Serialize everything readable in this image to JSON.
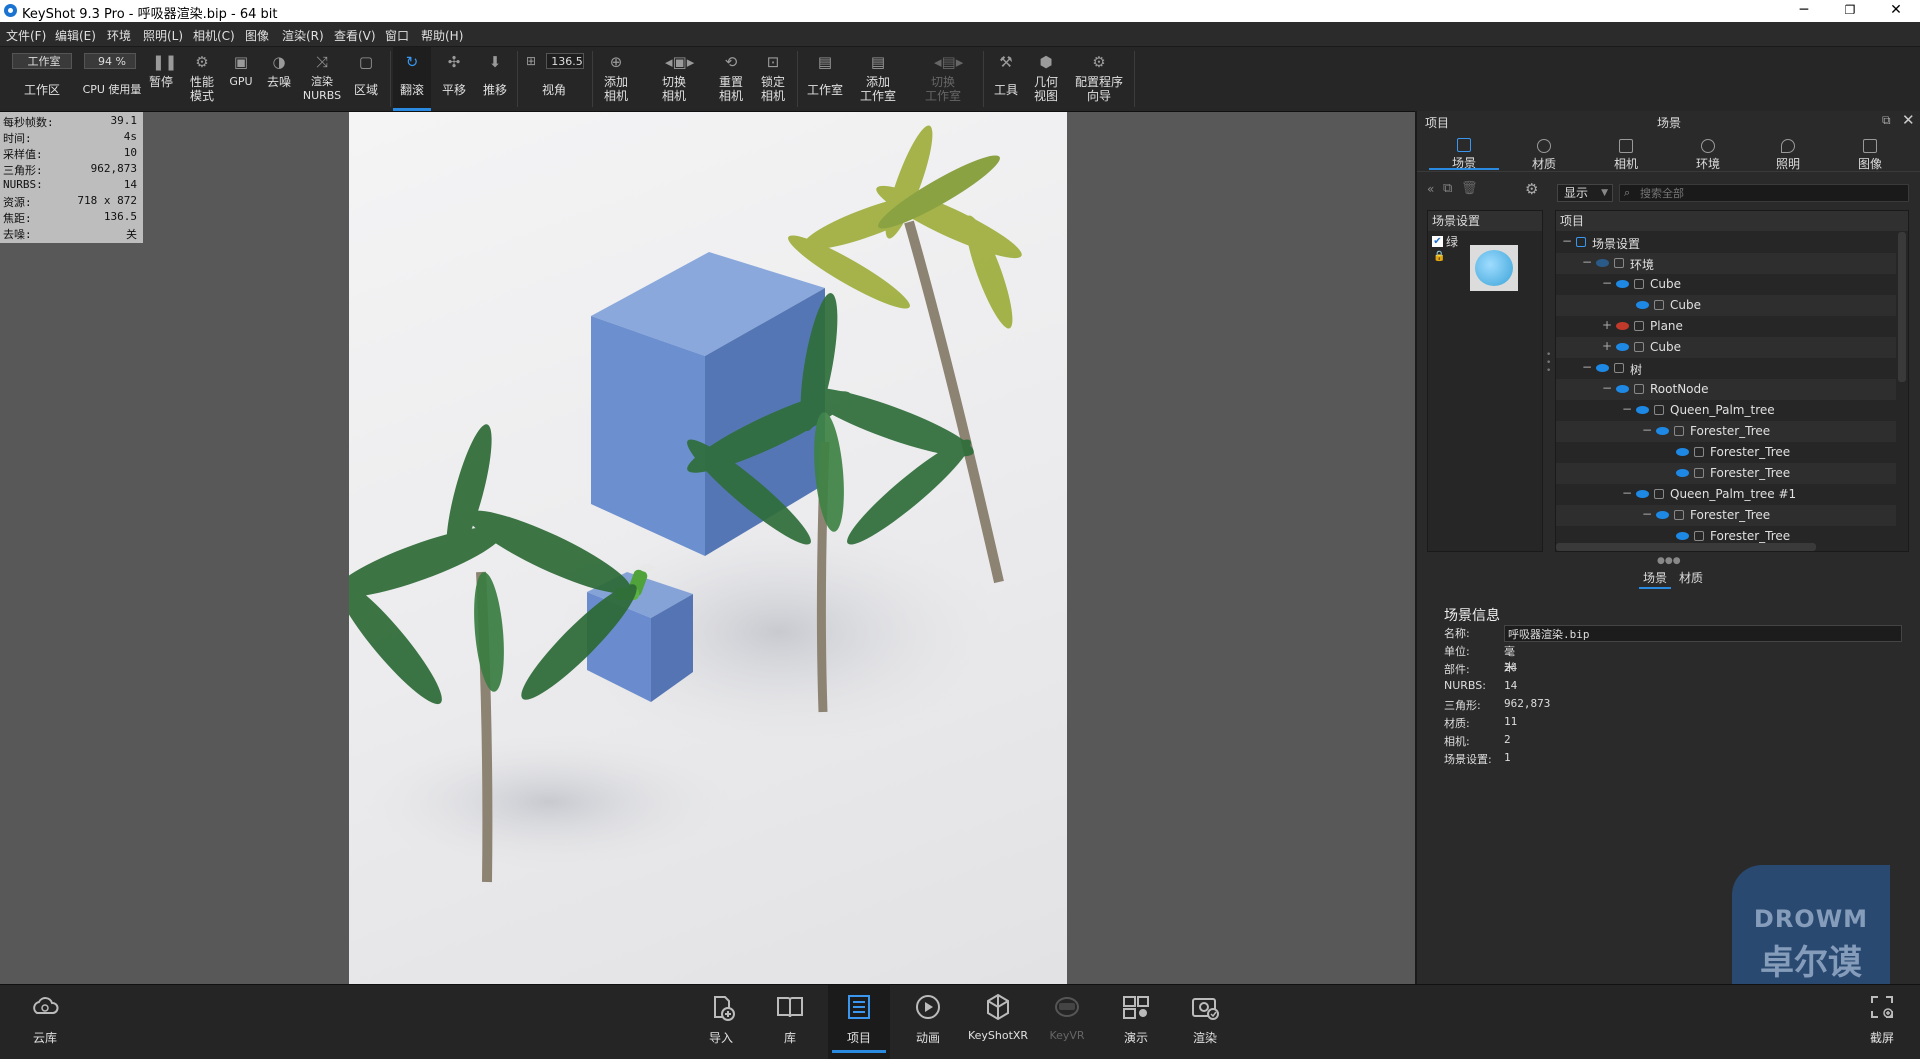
{
  "window": {
    "title": "KeyShot 9.3 Pro  - 呼吸器渲染.bip  - 64 bit",
    "minimize": "─",
    "maximize": "❐",
    "close": "✕"
  },
  "menu": [
    "文件(F)",
    "编辑(E)",
    "环境",
    "照明(L)",
    "相机(C)",
    "图像",
    "渲染(R)",
    "查看(V)",
    "窗口",
    "帮助(H)"
  ],
  "toolbar": {
    "workspace_select": "工作室",
    "workspace_label": "工作区",
    "cpu_select": "94 %",
    "cpu_label": "CPU 使用量",
    "pause": "暂停",
    "perf": [
      "性能",
      "模式"
    ],
    "gpu": "GPU",
    "denoise": "去噪",
    "nurbs": [
      "渲染",
      "NURBS"
    ],
    "region": "区域",
    "tumble": "翻滚",
    "pan": "平移",
    "dolly": "推移",
    "fov_value": "136.5",
    "fov_label": "视角",
    "add_camera": [
      "添加",
      "相机"
    ],
    "switch_camera": [
      "切换",
      "相机"
    ],
    "reset_camera": [
      "重置",
      "相机"
    ],
    "lock_camera": [
      "锁定",
      "相机"
    ],
    "studio": "工作室",
    "add_studio": [
      "添加",
      "工作室"
    ],
    "switch_studio": [
      "切换",
      "工作室"
    ],
    "tools": "工具",
    "geometry": [
      "几何",
      "视图"
    ],
    "wizard": [
      "配置程序",
      "向导"
    ]
  },
  "stats": [
    {
      "k": "每秒帧数:",
      "v": "39.1"
    },
    {
      "k": "时间:",
      "v": "4s"
    },
    {
      "k": "采样值:",
      "v": "10"
    },
    {
      "k": "三角形:",
      "v": "962,873"
    },
    {
      "k": "NURBS:",
      "v": "14"
    },
    {
      "k": "资源:",
      "v": "718 x 872"
    },
    {
      "k": "焦距:",
      "v": "136.5"
    },
    {
      "k": "去噪:",
      "v": "关"
    }
  ],
  "panel": {
    "left_title": "项目",
    "center_title": "场景",
    "tabs": [
      "场景",
      "材质",
      "相机",
      "环境",
      "照明",
      "图像"
    ],
    "show_select": "显示",
    "search_placeholder": "搜索全部",
    "scene_settings_header": "场景设置",
    "scene_item": "绿",
    "tree_header": "项目",
    "tree": [
      {
        "label": "场景设置",
        "indent": 0,
        "exp": "−"
      },
      {
        "label": "环境",
        "indent": 1,
        "exp": "−",
        "eye": "dim"
      },
      {
        "label": "Cube",
        "indent": 2,
        "exp": "−",
        "eye": "on"
      },
      {
        "label": "Cube",
        "indent": 3,
        "exp": "",
        "eye": "on"
      },
      {
        "label": "Plane",
        "indent": 2,
        "exp": "+",
        "eye": "red"
      },
      {
        "label": "Cube",
        "indent": 2,
        "exp": "+",
        "eye": "on"
      },
      {
        "label": "树",
        "indent": 1,
        "exp": "−",
        "eye": "on"
      },
      {
        "label": "RootNode",
        "indent": 2,
        "exp": "−",
        "eye": "on"
      },
      {
        "label": "Queen_Palm_tree",
        "indent": 3,
        "exp": "−",
        "eye": "on"
      },
      {
        "label": "Forester_Tree",
        "indent": 4,
        "exp": "−",
        "eye": "on"
      },
      {
        "label": "Forester_Tree",
        "indent": 5,
        "exp": "",
        "eye": "on"
      },
      {
        "label": "Forester_Tree",
        "indent": 5,
        "exp": "",
        "eye": "on"
      },
      {
        "label": "Queen_Palm_tree #1",
        "indent": 3,
        "exp": "−",
        "eye": "on"
      },
      {
        "label": "Forester_Tree",
        "indent": 4,
        "exp": "−",
        "eye": "on"
      },
      {
        "label": "Forester_Tree",
        "indent": 5,
        "exp": "",
        "eye": "on"
      }
    ],
    "subtabs": [
      "场景",
      "材质"
    ],
    "info_title": "场景信息",
    "info_name_label": "名称:",
    "info_name_value": "呼吸器渲染.bip",
    "info": [
      {
        "k": "单位:",
        "v": "毫米"
      },
      {
        "k": "部件:",
        "v": "24"
      },
      {
        "k": "NURBS:",
        "v": "14"
      },
      {
        "k": "三角形:",
        "v": "962,873"
      },
      {
        "k": "材质:",
        "v": "11"
      },
      {
        "k": "相机:",
        "v": "2"
      },
      {
        "k": "场景设置:",
        "v": "1"
      }
    ]
  },
  "bottom": {
    "cloud": "云库",
    "buttons": [
      "导入",
      "库",
      "项目",
      "动画",
      "KeyShotXR",
      "KeyVR",
      "演示",
      "渲染"
    ],
    "screenshot": "截屏"
  },
  "watermark": {
    "top": "DROWM",
    "bottom": "卓尔谟"
  },
  "colors": {
    "accent": "#2a8ae0",
    "cube": "#6b8fcf",
    "palm_green": "#3d7a3a"
  }
}
